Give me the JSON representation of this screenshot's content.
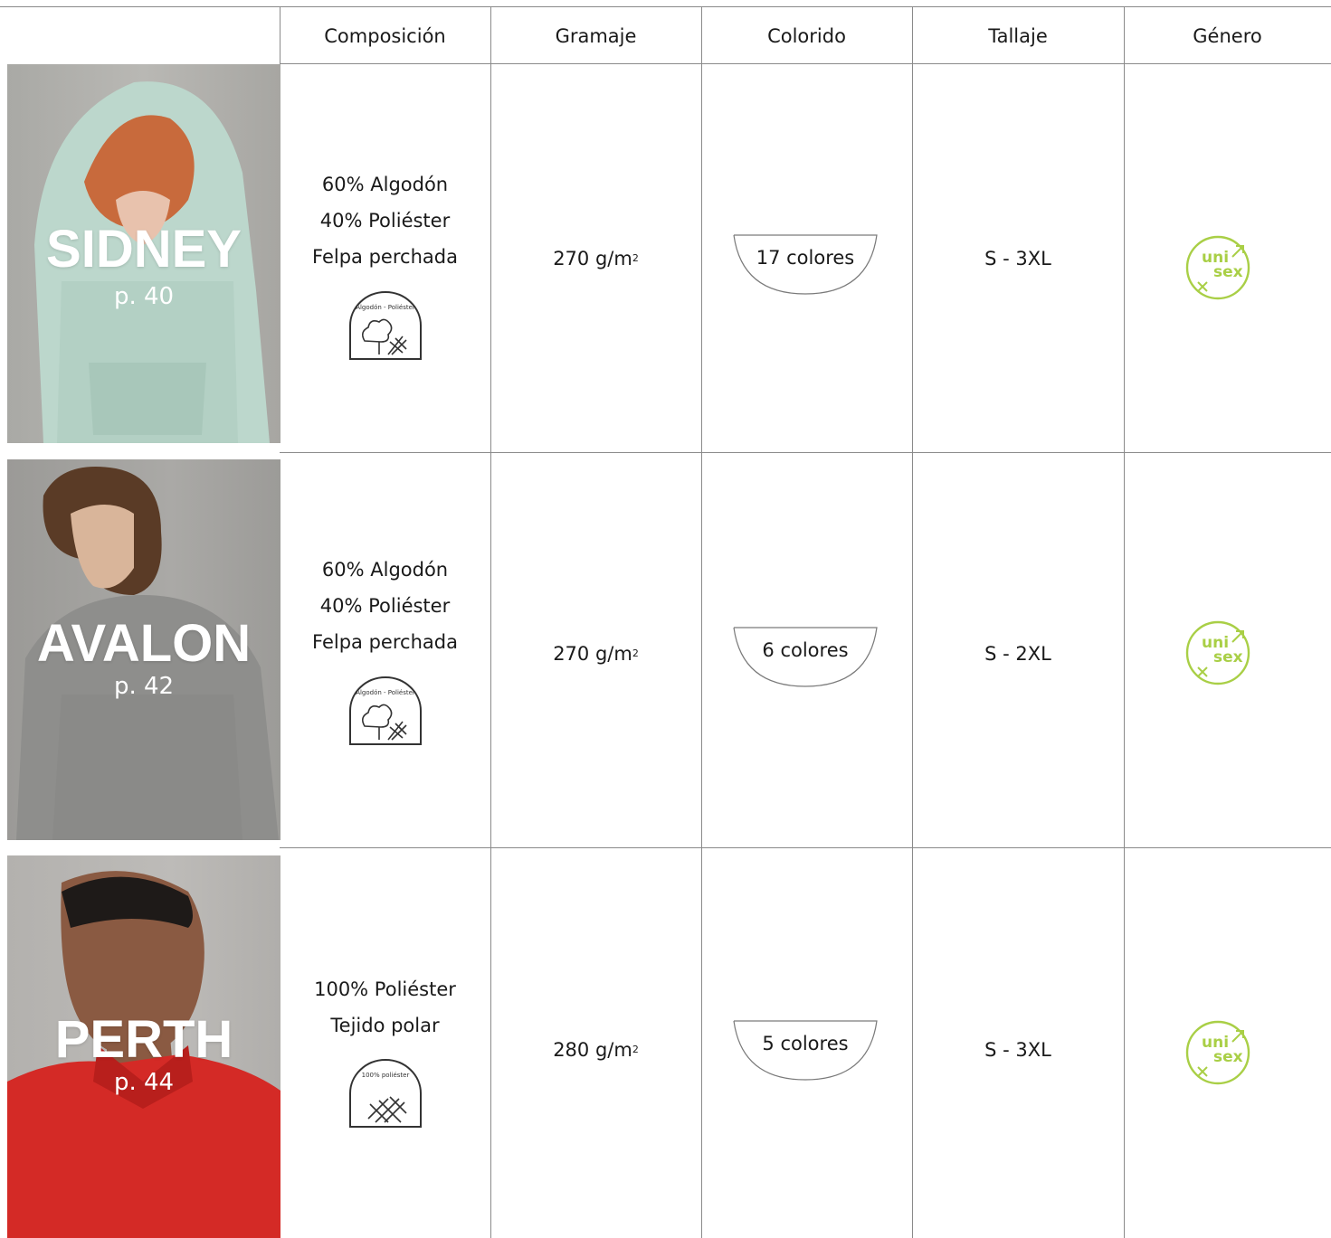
{
  "header": {
    "composition": "Composición",
    "weight": "Gramaje",
    "colours": "Colorido",
    "sizes": "Tallaje",
    "gender": "Género"
  },
  "products": [
    {
      "name": "SIDNEY",
      "page": "p. 40",
      "composition": [
        "60% Algodón",
        "40% Poliéster",
        "Felpa perchada"
      ],
      "badge_text": "Algodón - Poliéster",
      "weight": "270 g/m",
      "weight_sup": "2",
      "colours": "17 colores",
      "sizes": "S - 3XL",
      "gender_icon": "unisex-icon",
      "gender_top": "uni",
      "gender_bottom": "sex"
    },
    {
      "name": "AVALON",
      "page": "p. 42",
      "composition": [
        "60% Algodón",
        "40% Poliéster",
        "Felpa perchada"
      ],
      "badge_text": "Algodón - Poliéster",
      "weight": "270 g/m",
      "weight_sup": "2",
      "colours": "6 colores",
      "sizes": "S - 2XL",
      "gender_icon": "unisex-icon",
      "gender_top": "uni",
      "gender_bottom": "sex"
    },
    {
      "name": "PERTH",
      "page": "p. 44",
      "composition": [
        "100% Poliéster",
        "Tejido polar"
      ],
      "badge_text": "100% poliéster",
      "weight": "280 g/m",
      "weight_sup": "2",
      "colours": "5 colores",
      "sizes": "S - 3XL",
      "gender_icon": "unisex-icon",
      "gender_top": "uni",
      "gender_bottom": "sex"
    }
  ],
  "colors": {
    "unisex_green": "#a9cf46",
    "rule": "#8a8a8a"
  }
}
